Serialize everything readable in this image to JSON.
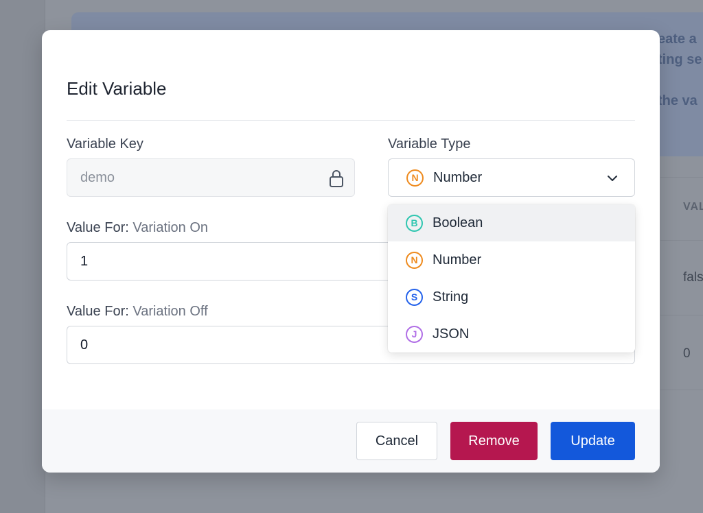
{
  "background": {
    "banner_fragments": [
      "eate a",
      "ting se",
      "the va"
    ],
    "column_header_fragment": "VAL",
    "cell_fragments": [
      "fals",
      "0"
    ]
  },
  "modal": {
    "title": "Edit Variable",
    "variable_key": {
      "label": "Variable Key",
      "value": "demo",
      "locked": true
    },
    "variable_type": {
      "label": "Variable Type",
      "selected": {
        "label": "Number",
        "badge": "N",
        "color": "#ee8b1f"
      },
      "options": [
        {
          "label": "Boolean",
          "badge": "B",
          "color": "#2fc6b0",
          "highlighted": true
        },
        {
          "label": "Number",
          "badge": "N",
          "color": "#ee8b1f",
          "highlighted": false
        },
        {
          "label": "String",
          "badge": "S",
          "color": "#2563eb",
          "highlighted": false
        },
        {
          "label": "JSON",
          "badge": "J",
          "color": "#b06ee6",
          "highlighted": false
        }
      ]
    },
    "value_on": {
      "label_prefix": "Value For:",
      "label_variation": "Variation On",
      "value": "1"
    },
    "value_off": {
      "label_prefix": "Value For:",
      "label_variation": "Variation Off",
      "value": "0"
    },
    "buttons": {
      "cancel": "Cancel",
      "remove": "Remove",
      "update": "Update"
    },
    "colors": {
      "remove": "#b5174f",
      "update": "#1358db"
    }
  }
}
